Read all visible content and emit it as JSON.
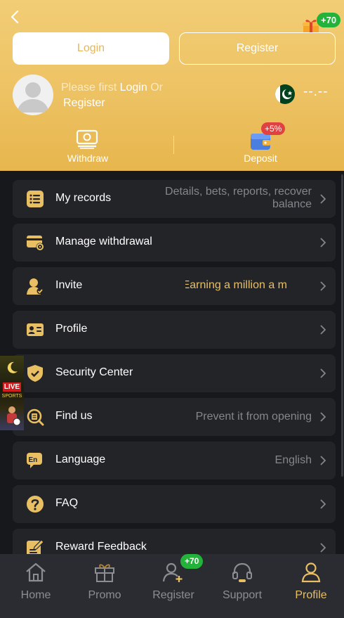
{
  "header": {
    "gift_badge": "+70",
    "login_label": "Login",
    "register_label": "Register",
    "hint_prefix": "Please first ",
    "hint_login": "Login",
    "hint_or": " Or",
    "hint_register": "Register",
    "balance": "--.--",
    "withdraw_label": "Withdraw",
    "deposit_label": "Deposit",
    "deposit_badge": "+5%"
  },
  "menu": [
    {
      "label": "My records",
      "sub": "Details, bets, reports, recover",
      "sub2": "balance",
      "icon": "records-icon"
    },
    {
      "label": "Manage withdrawal",
      "sub": "",
      "icon": "card-settings-icon"
    },
    {
      "label": "Invite",
      "marquee": "onth  Earning a million a m",
      "icon": "user-invite-icon"
    },
    {
      "label": "Profile",
      "sub": "",
      "icon": "id-card-icon"
    },
    {
      "label": "Security Center",
      "sub": "",
      "icon": "shield-check-icon"
    },
    {
      "label": "Find us",
      "sub": "Prevent it from opening",
      "icon": "search-document-icon"
    },
    {
      "label": "Language",
      "sub": "English",
      "icon": "language-icon"
    },
    {
      "label": "FAQ",
      "sub": "",
      "icon": "question-icon"
    },
    {
      "label": "Reward Feedback",
      "sub": "",
      "icon": "feedback-icon"
    }
  ],
  "side_banner": {
    "live": "LIVE",
    "sports": "SPORTS"
  },
  "nav": {
    "home": "Home",
    "promo": "Promo",
    "register": "Register",
    "support": "Support",
    "profile": "Profile",
    "register_badge": "+70"
  },
  "colors": {
    "accent": "#e9bf63",
    "header_gold": "#edc263",
    "background": "#17181c",
    "card": "#232428",
    "badge_green": "#23b23a",
    "badge_red": "#e04141"
  }
}
